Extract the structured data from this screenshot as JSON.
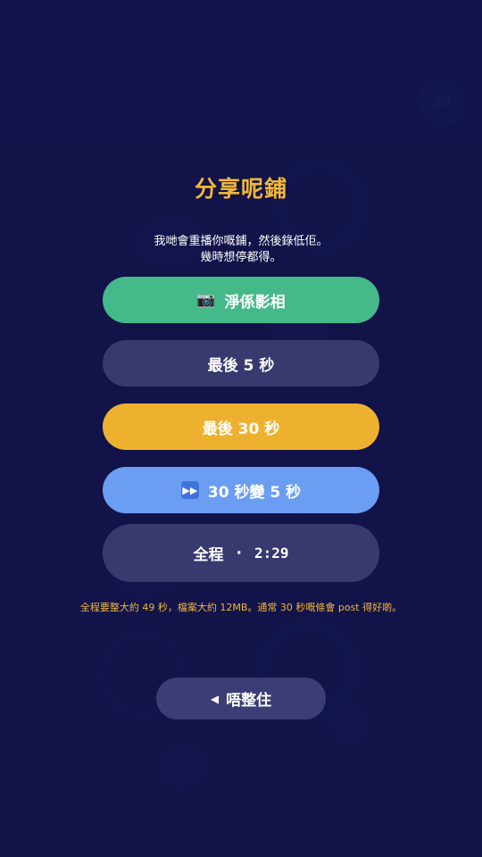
{
  "background": {
    "timer_text": "30"
  },
  "dialog": {
    "title": "分享呢鋪",
    "description_line1": "我哋會重播你嘅鋪，然後錄低佢。",
    "description_line2": "幾時想停都得。",
    "options": [
      {
        "label": "淨係影相",
        "icon": "camera-icon"
      },
      {
        "label": "最後 5 秒"
      },
      {
        "label": "最後 30 秒"
      },
      {
        "label": "30 秒變 5 秒",
        "icon": "fast-forward-icon"
      },
      {
        "label": "全程",
        "separator": "·",
        "duration": "2:29"
      }
    ],
    "note": "全程要整大約 49 秒，檔案大約 12MB。通常 30 秒嘅條會 post 得好啲。",
    "cancel_label": "唔整住"
  },
  "colors": {
    "background": "#15174f",
    "accent_gold": "#f1b63a",
    "green": "#45b98a",
    "blue": "#6b9ef3",
    "muted": "#37396f"
  }
}
